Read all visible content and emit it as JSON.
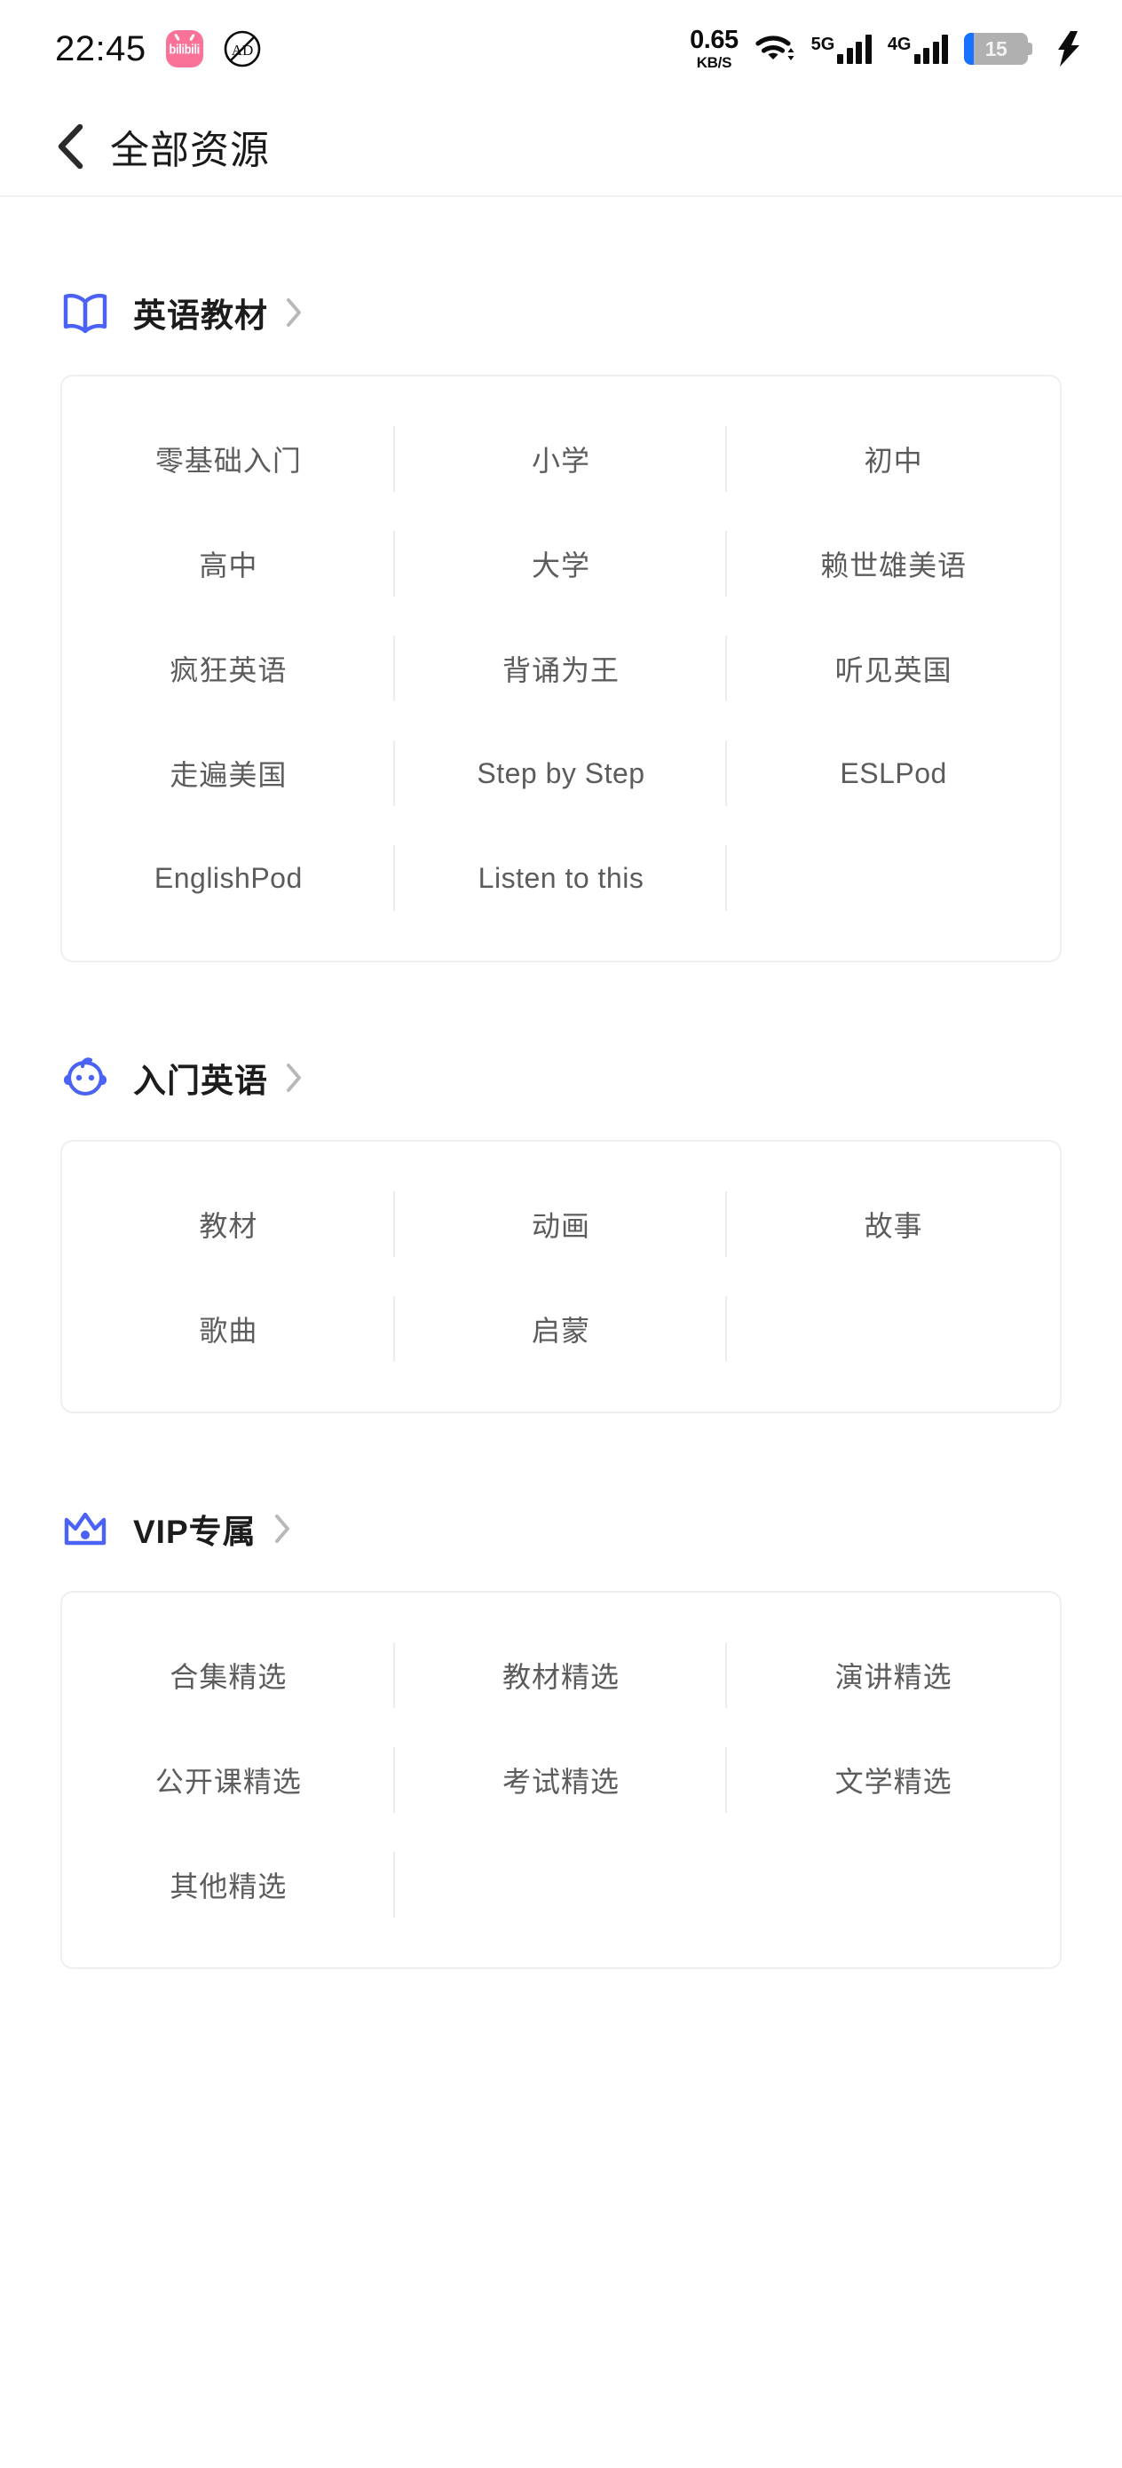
{
  "statusbar": {
    "time": "22:45",
    "bili_label": "bilibili",
    "adblock_name": "ad-block",
    "netspeed_value": "0.65",
    "netspeed_unit": "KB/S",
    "sim1_label": "5G",
    "sim2_label": "4G",
    "battery_level": "15",
    "battery_charging": true,
    "battery_fill_color": "#1872ff"
  },
  "navbar": {
    "back_label": "back",
    "title": "全部资源"
  },
  "theme": {
    "accent": "#4a62f5",
    "text_primary": "#1c1c1c",
    "text_secondary": "#5c5c5c",
    "border": "#efefef"
  },
  "sections": [
    {
      "id": "english-textbooks",
      "icon": "book-icon",
      "title": "英语教材",
      "chevron": "chevron-right-icon",
      "items": [
        "零基础入门",
        "小学",
        "初中",
        "高中",
        "大学",
        "赖世雄美语",
        "疯狂英语",
        "背诵为王",
        "听见英国",
        "走遍美国",
        "Step by Step",
        "ESLPod",
        "EnglishPod",
        "Listen to this"
      ]
    },
    {
      "id": "beginner-english",
      "icon": "baby-face-icon",
      "title": "入门英语",
      "chevron": "chevron-right-icon",
      "items": [
        "教材",
        "动画",
        "故事",
        "歌曲",
        "启蒙"
      ]
    },
    {
      "id": "vip-exclusive",
      "icon": "crown-icon",
      "title": "VIP专属",
      "chevron": "chevron-right-icon",
      "items": [
        "合集精选",
        "教材精选",
        "演讲精选",
        "公开课精选",
        "考试精选",
        "文学精选",
        "其他精选"
      ]
    }
  ]
}
